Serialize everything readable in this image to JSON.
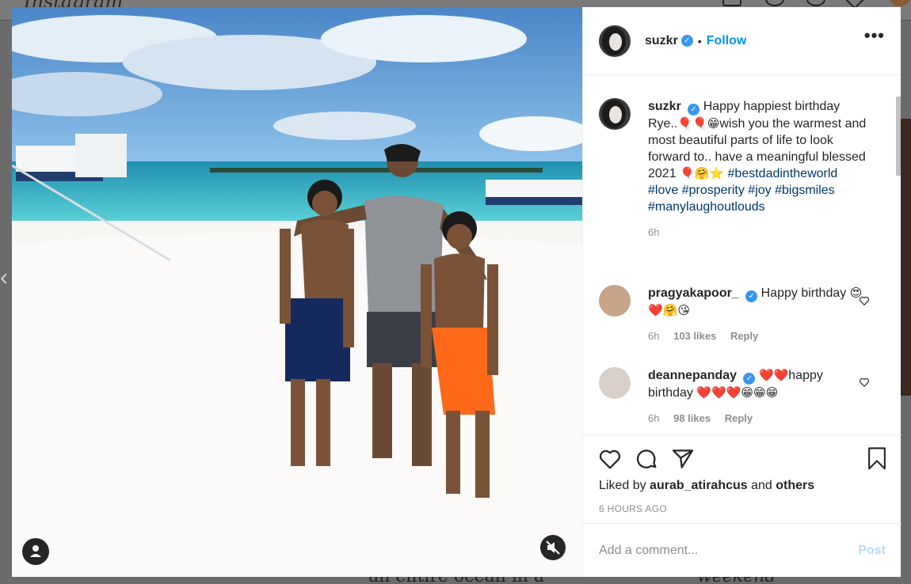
{
  "background": {
    "logo": "Instagram",
    "bottom_text": "an entire ocean in a",
    "bottom_script": "weekend"
  },
  "post": {
    "username": "suzkr",
    "follow_label": "Follow",
    "more_label": "•••",
    "caption_user": "suzkr",
    "caption_text_1": "Happy happiest birthday Rye..",
    "caption_emoji_1": "🎈🎈😁",
    "caption_text_2": "wish you the warmest and most beautiful parts of life to look forward to.. have a meaningful blessed 2021",
    "caption_emoji_2": "🎈🤗⭐",
    "hashtags": "#bestdadintheworld #love #prosperity #joy #bigsmiles #manylaughoutlouds",
    "caption_time": "6h",
    "liked_by_prefix": "Liked by",
    "liked_by_user": "aurab_atirahcus",
    "liked_by_and": "and",
    "liked_by_others": "others",
    "time_ago": "6 HOURS AGO",
    "comment_placeholder": "Add a comment...",
    "post_label": "Post"
  },
  "comments": [
    {
      "user": "pragyakapoor_",
      "text": "Happy birthday",
      "emoji": "😍❤️🤗😘",
      "time": "6h",
      "likes": "103 likes",
      "reply": "Reply"
    },
    {
      "user": "deannepanday",
      "emoji_pre": "❤️❤️",
      "text": "happy birthday",
      "emoji": "❤️❤️❤️😁😁😁",
      "time": "6h",
      "likes": "98 likes",
      "reply": "Reply"
    }
  ],
  "colors": {
    "accent": "#0095f6",
    "verified": "#3897f0",
    "hashtag": "#00376b",
    "post_disabled": "#b2dffc"
  }
}
